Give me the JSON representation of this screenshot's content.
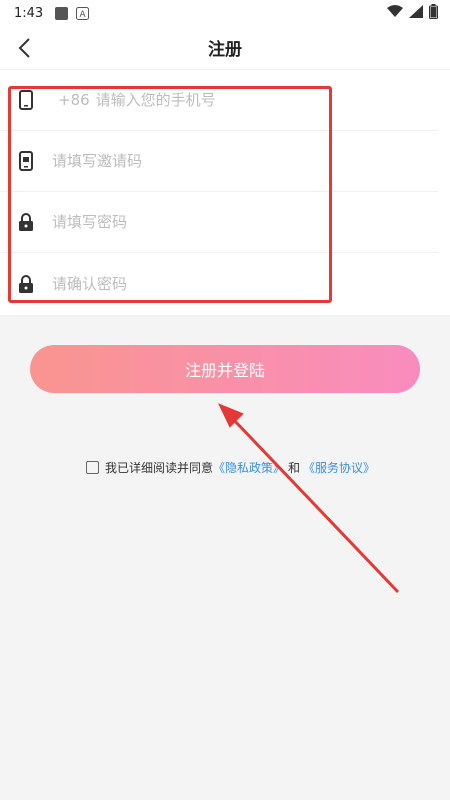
{
  "status_bar": {
    "time": "1:43"
  },
  "header": {
    "title": "注册",
    "back_icon": "chevron-left-icon"
  },
  "form": {
    "phone": {
      "prefix": "+86",
      "placeholder": "请输入您的手机号",
      "icon": "phone-icon"
    },
    "invite": {
      "placeholder": "请填写邀请码",
      "icon": "invite-code-icon"
    },
    "password": {
      "placeholder": "请填写密码",
      "icon": "lock-icon"
    },
    "confirm": {
      "placeholder": "请确认密码",
      "icon": "lock-icon"
    }
  },
  "submit_label": "注册并登陆",
  "agreement": {
    "text": "我已详细阅读并同意",
    "privacy_link": "《隐私政策》",
    "and": "和",
    "service_link": "《服务协议》"
  },
  "colors": {
    "annotation_red": "#e53935",
    "button_start": "#f9958f",
    "button_end": "#f98cbf",
    "link_blue": "#3d8fe0"
  }
}
